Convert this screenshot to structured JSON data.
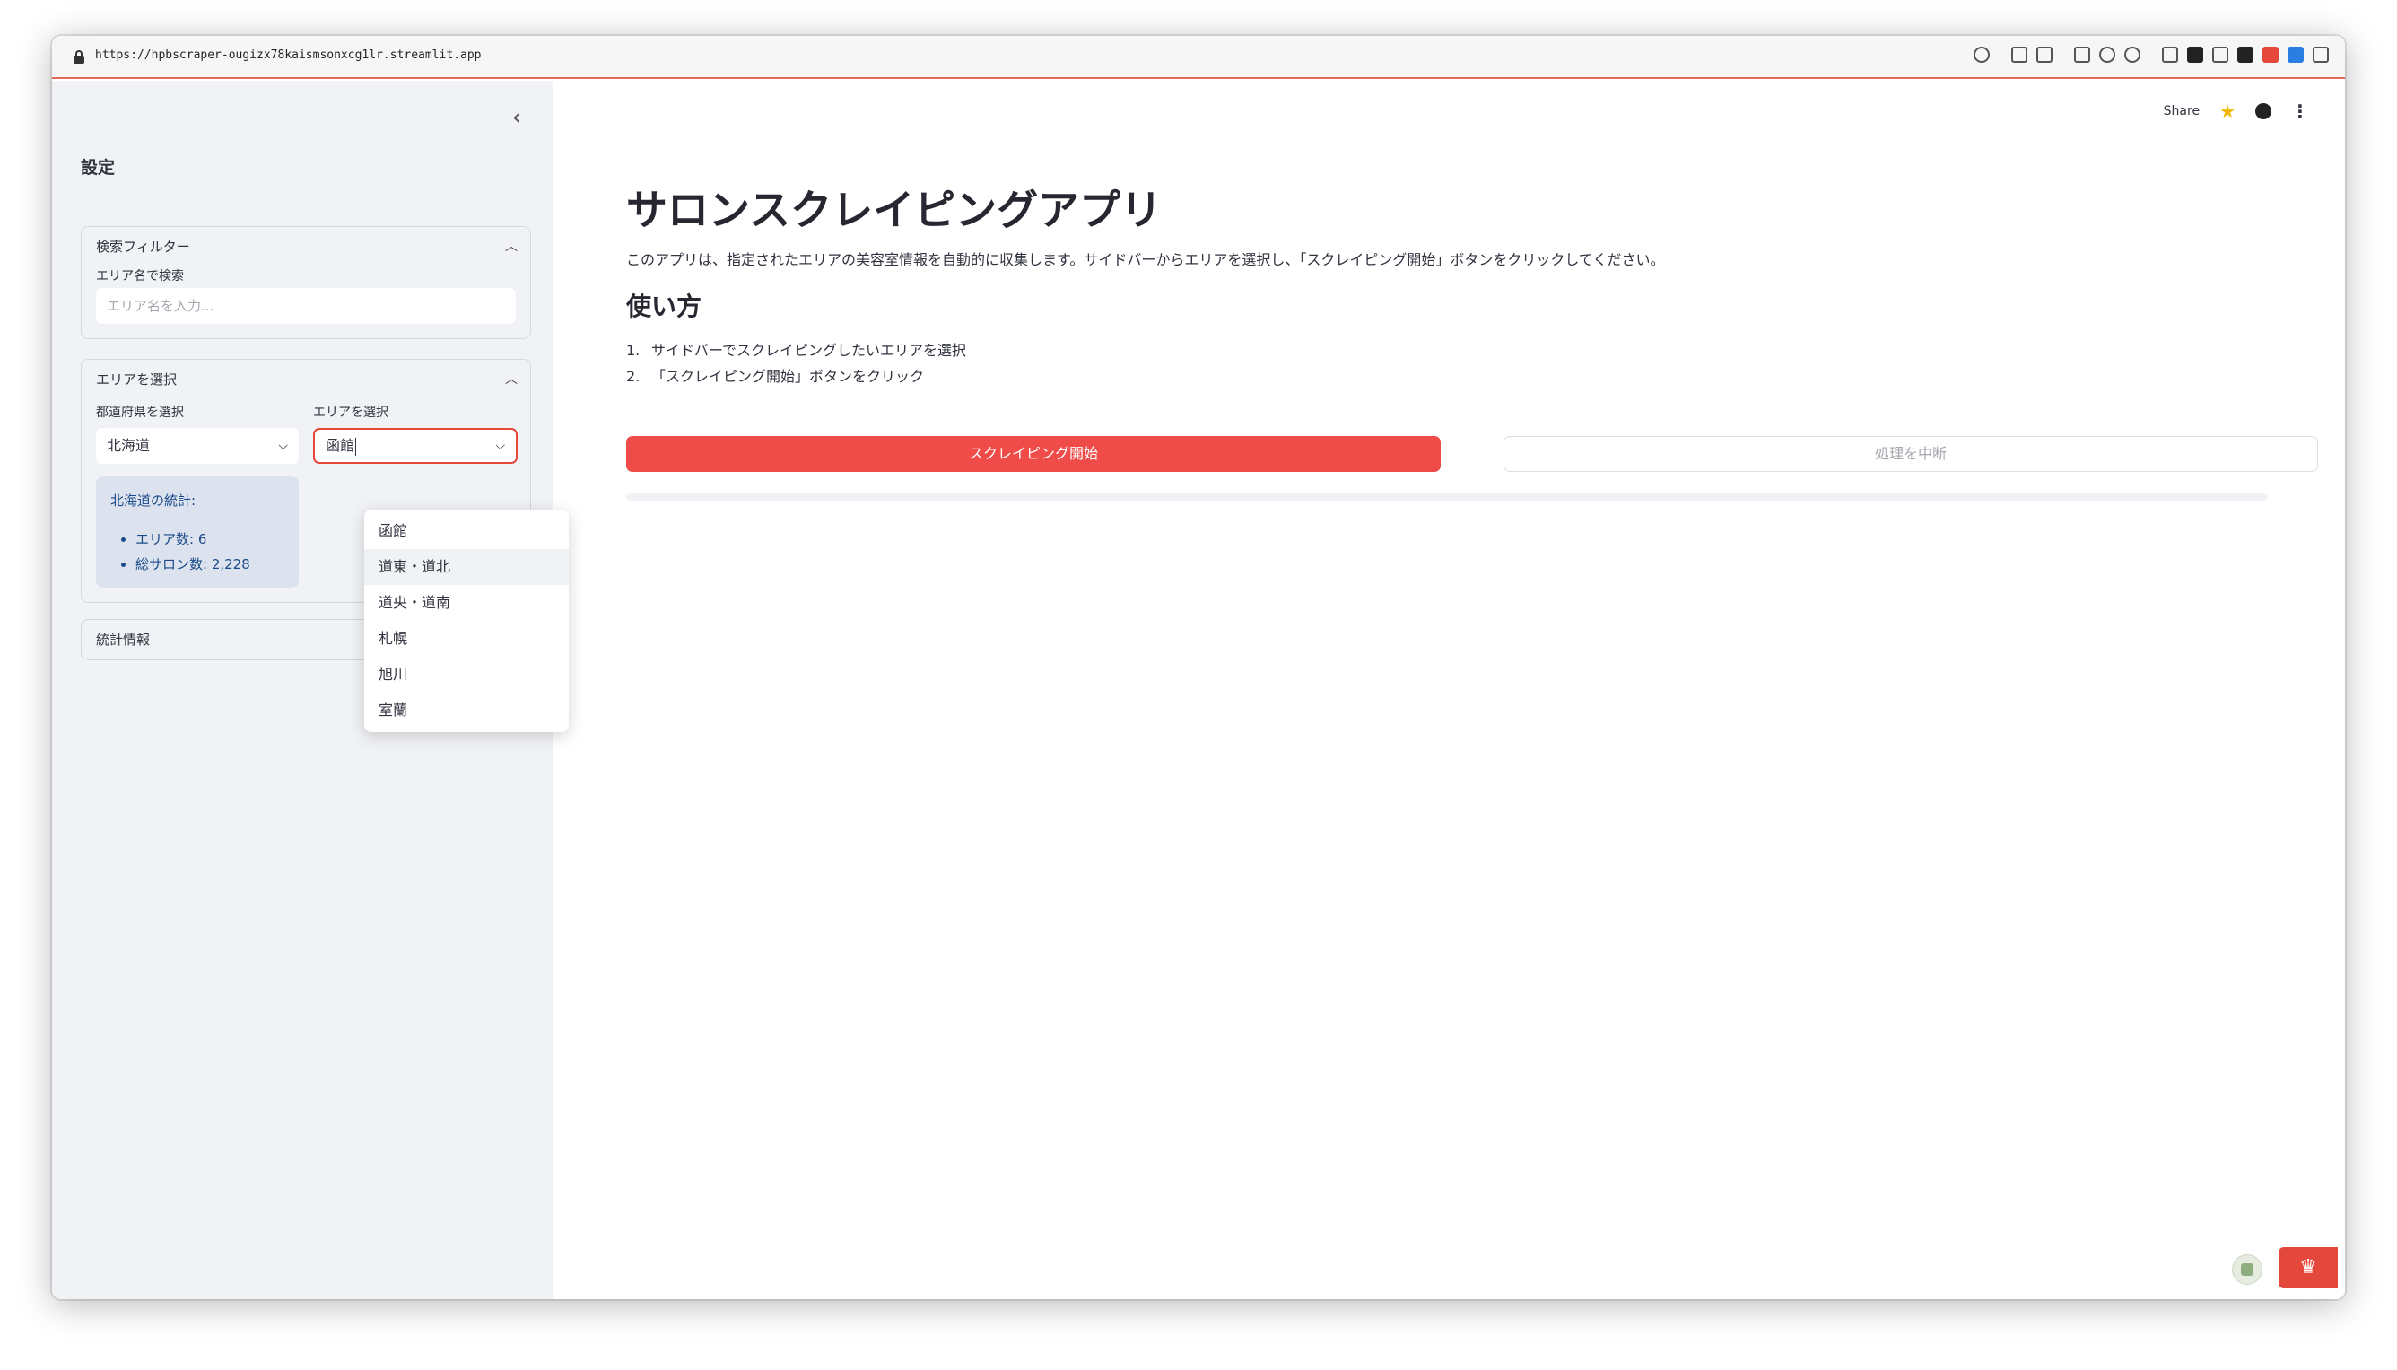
{
  "browser": {
    "url": "https://hpbscraper-ougizx78kaismsonxcg1lr.streamlit.app"
  },
  "sidebar": {
    "collapse_icon": "‹",
    "title": "設定",
    "search_filter": {
      "header": "検索フィルター",
      "field_label": "エリア名で検索",
      "placeholder": "エリア名を入力..."
    },
    "area_select": {
      "header": "エリアを選択",
      "prefecture_label": "都道府県を選択",
      "prefecture_value": "北海道",
      "area_label": "エリアを選択",
      "area_value": "函館",
      "dropdown_options": [
        "函館",
        "道東・道北",
        "道央・道南",
        "札幌",
        "旭川",
        "室蘭"
      ],
      "highlighted_option": "道東・道北"
    },
    "stats": {
      "title": "北海道の統計:",
      "area_count": "エリア数: 6",
      "salon_count": "総サロン数: 2,228"
    },
    "stats_info": {
      "header": "統計情報"
    }
  },
  "main": {
    "share_label": "Share",
    "title": "サロンスクレイピングアプリ",
    "description": "このアプリは、指定されたエリアの美容室情報を自動的に収集します。サイドバーからエリアを選択し、「スクレイピング開始」ボタンをクリックしてください。",
    "howto_heading": "使い方",
    "steps": [
      {
        "num": "1.",
        "text": "サイドバーでスクレイピングしたいエリアを選択"
      },
      {
        "num": "2.",
        "text": "「スクレイピング開始」ボタンをクリック"
      }
    ],
    "start_button": "スクレイピング開始",
    "stop_button": "処理を中断",
    "progress": 0
  },
  "colors": {
    "accent": "#ee4b49",
    "sidebar_bg": "#f0f2f6",
    "info_bg": "#dce3ee",
    "info_text": "#1b4a8a"
  },
  "icons": [
    "lock-icon",
    "link-icon",
    "star-icon",
    "github-icon",
    "more-vert-icon",
    "chevron-up-icon",
    "chevron-down-icon",
    "crown-icon"
  ]
}
